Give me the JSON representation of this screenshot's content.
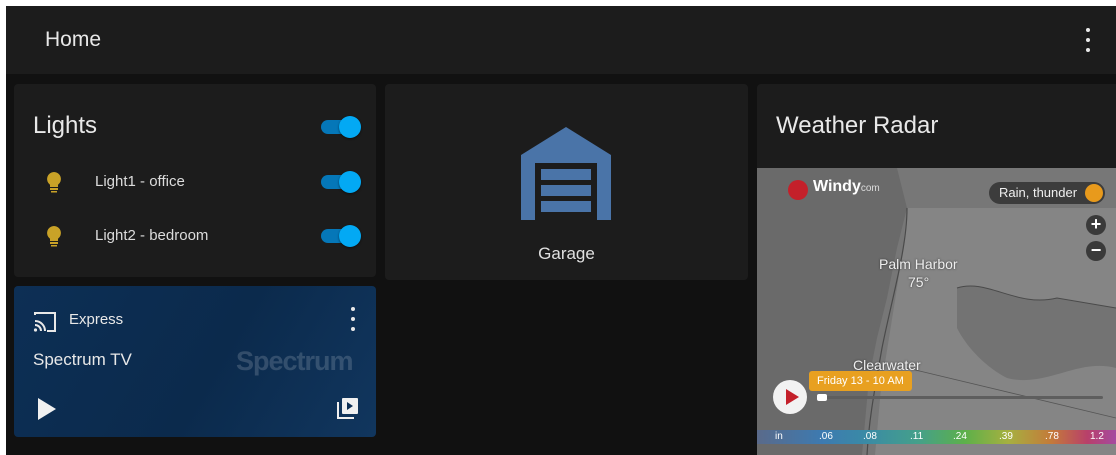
{
  "header": {
    "title": "Home"
  },
  "lights": {
    "title": "Lights",
    "items": [
      {
        "label": "Light1 - office"
      },
      {
        "label": "Light2 - bedroom"
      }
    ]
  },
  "garage": {
    "label": "Garage"
  },
  "weather": {
    "title": "Weather Radar",
    "brand": "Windy",
    "brand_suffix": "com",
    "layer": "Rain, thunder",
    "place1": "Palm Harbor",
    "temp": "75°",
    "place2": "Clearwater",
    "time": "Friday 13 - 10 AM",
    "zoom_in": "+",
    "zoom_out": "−",
    "scale": [
      "in",
      ".06",
      ".08",
      ".11",
      ".24",
      ".39",
      ".78",
      "1.2"
    ]
  },
  "media": {
    "app": "Express",
    "title": "Spectrum TV",
    "brand": "Spectrum"
  },
  "colors": {
    "accent": "#03a9f4",
    "bulb": "#c9a227",
    "garage": "#4a74a8",
    "card": "#1c1c1c"
  }
}
